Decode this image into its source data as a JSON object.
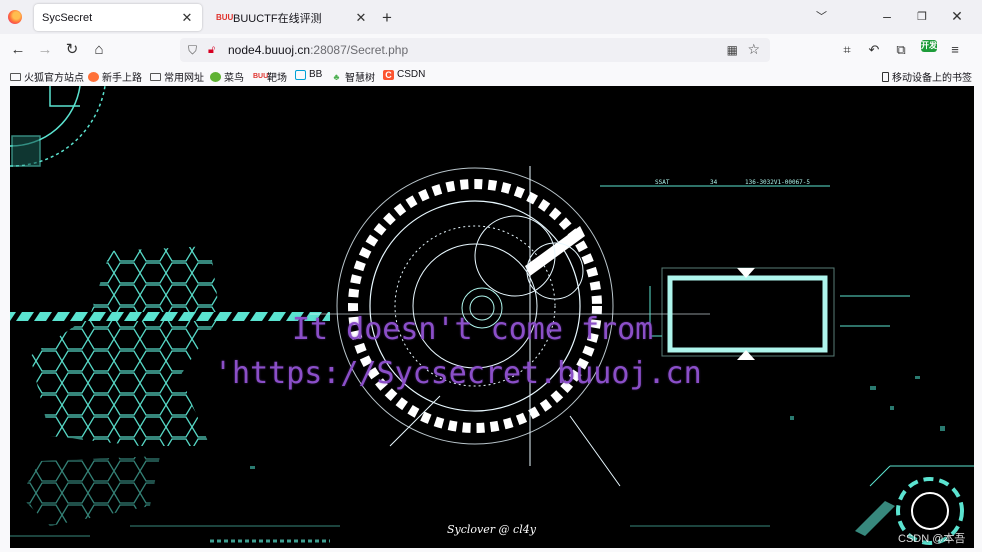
{
  "tabs": [
    {
      "title": "SycSecret",
      "active": true
    },
    {
      "title": "BUUCTF在线评测",
      "favicon": "BUU",
      "active": false
    }
  ],
  "navbar": {
    "url_host": "node4.buuoj.cn",
    "url_rest": ":28087/Secret.php"
  },
  "bookmarks": [
    {
      "label": "火狐官方站点",
      "icon": "folder-icon"
    },
    {
      "label": "新手上路",
      "icon": "firefox-icon"
    },
    {
      "label": "常用网址",
      "icon": "folder-icon"
    },
    {
      "label": "菜鸟",
      "icon": "runoob-icon"
    },
    {
      "label": "靶场",
      "icon": "buu-icon"
    },
    {
      "label": "BB",
      "icon": "bilibili-icon"
    },
    {
      "label": "智慧树",
      "icon": "tree-icon"
    },
    {
      "label": "CSDN",
      "icon": "csdn-icon"
    }
  ],
  "bookmarks_right": "移动设备上的书签",
  "extension_badge": "开发",
  "page": {
    "message_line1": "It doesn't come from",
    "message_line2": "'https://Sycsecret.buuoj.cn",
    "signature": "Syclover @ cl4y",
    "colors": {
      "message": "#8b4fc8",
      "accent": "#5be3d0",
      "background": "#000000"
    }
  },
  "watermark": "CSDN @本吾"
}
